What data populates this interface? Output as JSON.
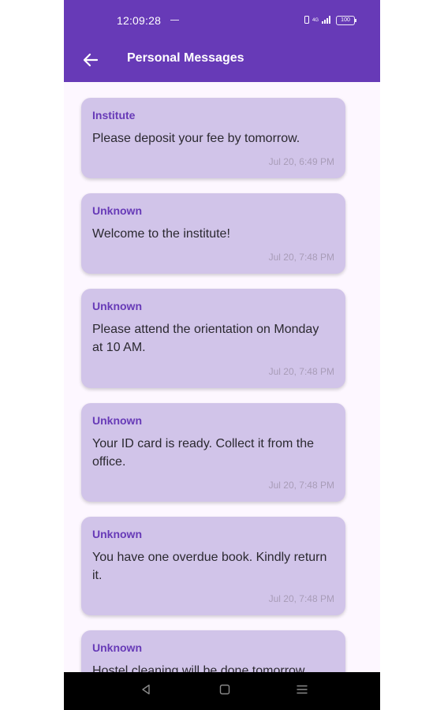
{
  "status_bar": {
    "time": "12:09:28",
    "network": "4G",
    "battery": "100"
  },
  "app_bar": {
    "title": "Personal Messages",
    "back_icon": "arrow-left-icon"
  },
  "messages": [
    {
      "sender": "Institute",
      "body": "Please deposit your fee by tomorrow.",
      "time": "Jul 20, 6:49 PM"
    },
    {
      "sender": "Unknown",
      "body": "Welcome to the institute!",
      "time": "Jul 20, 7:48 PM"
    },
    {
      "sender": "Unknown",
      "body": "Please attend the orientation on Monday at 10 AM.",
      "time": "Jul 20, 7:48 PM"
    },
    {
      "sender": "Unknown",
      "body": "Your ID card is ready. Collect it from the office.",
      "time": "Jul 20, 7:48 PM"
    },
    {
      "sender": "Unknown",
      "body": "You have one overdue book. Kindly return it.",
      "time": "Jul 20, 7:48 PM"
    },
    {
      "sender": "Unknown",
      "body": "Hostel cleaning will be done tomorrow.",
      "time": ""
    }
  ],
  "nav_bar": {
    "back_icon": "triangle-back-icon",
    "home_icon": "square-home-icon",
    "recents_icon": "menu-recents-icon"
  },
  "colors": {
    "primary": "#673ab7",
    "card": "#d1c4e9",
    "background": "#fdf7ff"
  }
}
